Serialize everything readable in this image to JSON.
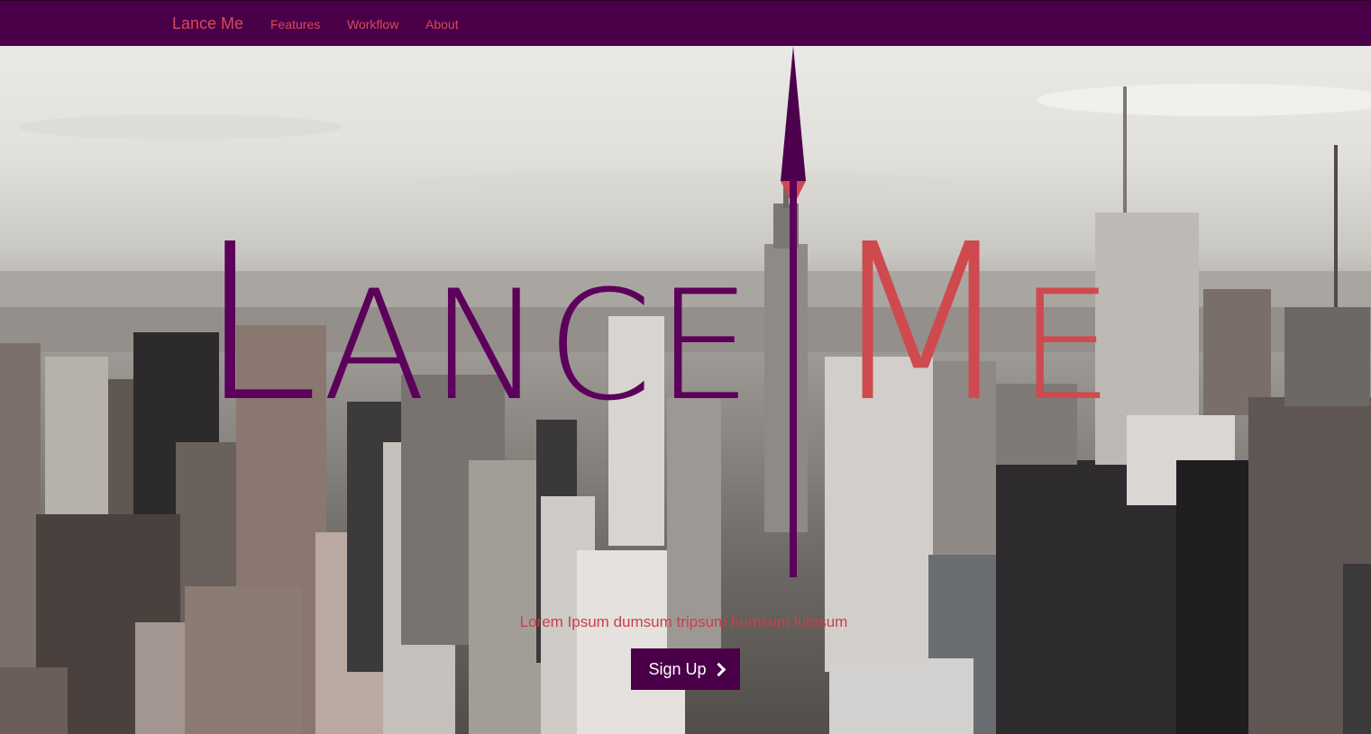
{
  "navbar": {
    "brand": "Lance Me",
    "links": [
      {
        "label": "Features"
      },
      {
        "label": "Workflow"
      },
      {
        "label": "About"
      }
    ]
  },
  "hero": {
    "logo_left": "Lance",
    "logo_right": "Me",
    "tagline": "Lorem Ipsum dumsum tripsum humsum lumsum",
    "signup_label": "Sign Up",
    "signup_icon": "chevron-right-icon"
  },
  "colors": {
    "navbar_bg": "#4a0049",
    "accent_red": "#d64a58",
    "logo_purple": "#5c005b",
    "logo_red": "#cf4a4f"
  }
}
